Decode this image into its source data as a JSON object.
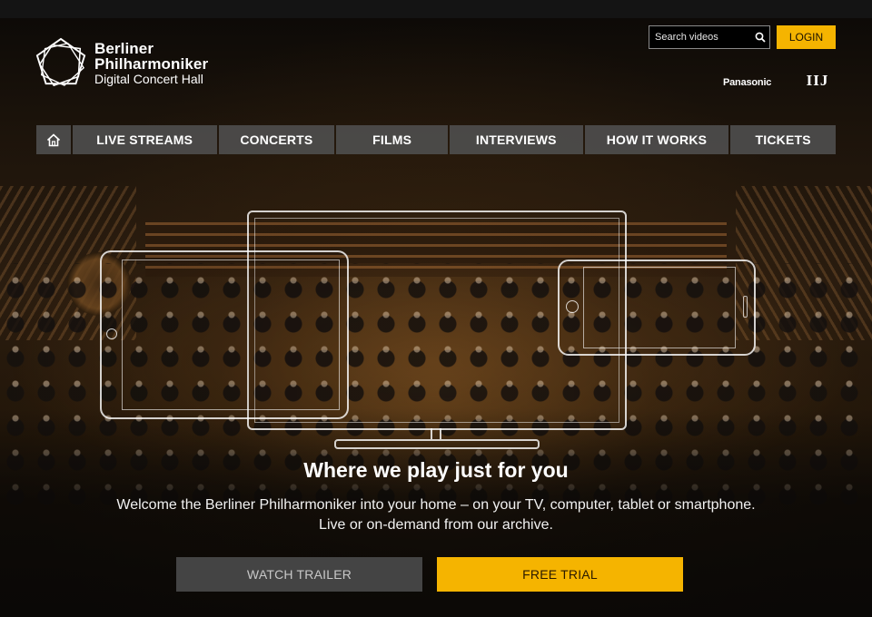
{
  "brand": {
    "line1": "Berliner",
    "line2": "Philharmoniker",
    "line3": "Digital Concert Hall"
  },
  "header": {
    "search_placeholder": "Search videos",
    "login_label": "LOGIN",
    "sponsors": [
      "Panasonic",
      "IIJ"
    ]
  },
  "nav": {
    "home_icon": "home-icon",
    "items": [
      "LIVE STREAMS",
      "CONCERTS",
      "FILMS",
      "INTERVIEWS",
      "HOW IT WORKS",
      "TICKETS"
    ]
  },
  "hero": {
    "headline": "Where we play just for you",
    "subtext": "Welcome the Berliner Philharmoniker into your home – on your TV, computer, tablet or smartphone. Live or on-demand from our archive.",
    "trailer_label": "WATCH TRAILER",
    "trial_label": "FREE TRIAL"
  },
  "colors": {
    "accent": "#f5b400",
    "nav_bg": "#505050",
    "trailer_bg": "#444444"
  }
}
